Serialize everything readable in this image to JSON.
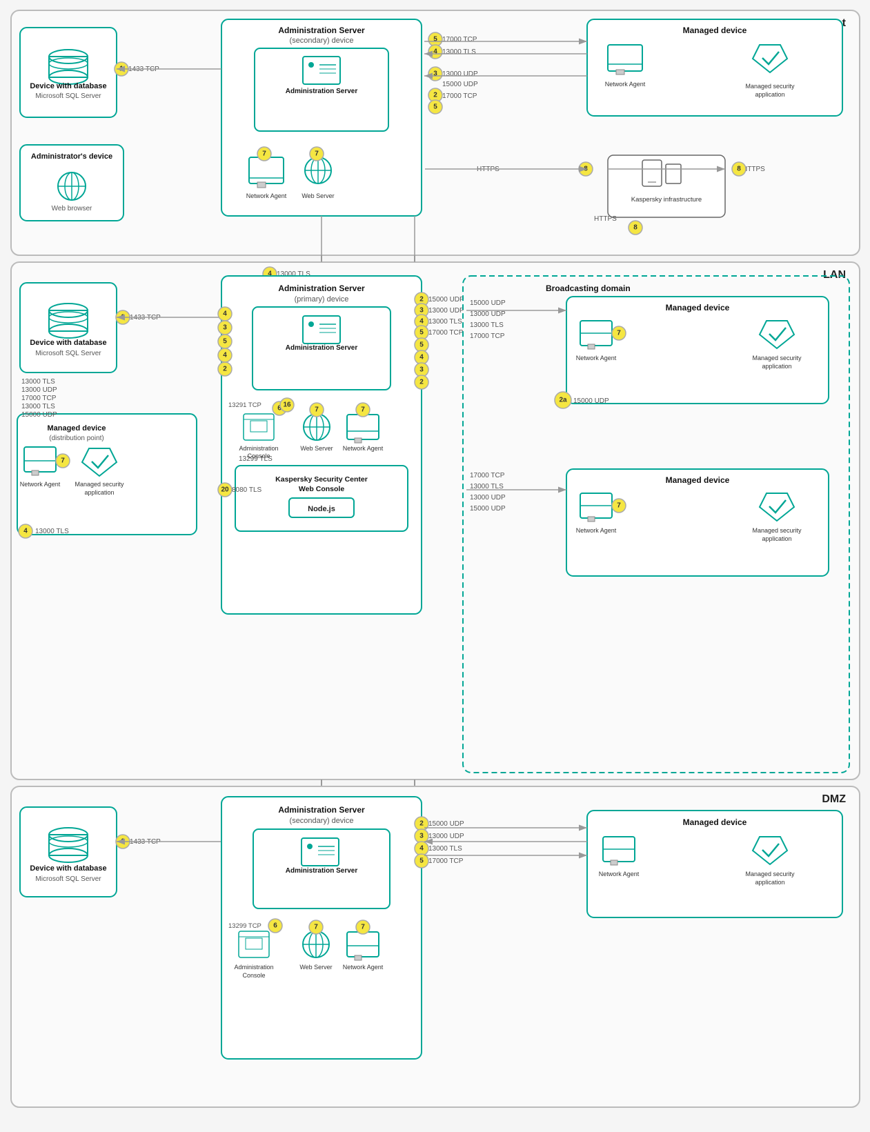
{
  "zones": {
    "internet": {
      "label": "Internet"
    },
    "lan": {
      "label": "LAN"
    },
    "dmz": {
      "label": "DMZ"
    }
  },
  "internet": {
    "db_device": {
      "title": "Device with database",
      "subtitle": "Microsoft SQL Server"
    },
    "admin_server_secondary": {
      "title": "Administration Server",
      "subtitle": "(secondary) device",
      "inner": "Administration Server"
    },
    "admin_device": {
      "title": "Administrator's device",
      "subtitle": "Web browser"
    },
    "managed_device": {
      "title": "Managed device",
      "network_agent": "Network Agent",
      "security_app": "Managed security application"
    },
    "network_agent_label": "Network Agent",
    "web_server_label": "Web Server",
    "kaspersky_infra": "Kaspersky infrastructure",
    "ports": {
      "p1": "1433 TCP",
      "p2": "17000 TCP",
      "p3_13000tls": "13000 TLS",
      "p4_13000udp": "13000 UDP",
      "p3b": "13000 UDP",
      "p2b": "15000 UDP",
      "p5b": "17000 TCP",
      "https1": "HTTPS",
      "https2": "HTTPS",
      "https3": "HTTPS"
    }
  },
  "lan": {
    "db_device": {
      "title": "Device with database",
      "subtitle": "Microsoft SQL Server"
    },
    "admin_server_primary": {
      "title": "Administration Server",
      "subtitle": "(primary) device",
      "inner": "Administration Server"
    },
    "ksc_webconsole": {
      "title": "Kaspersky Security Center\nWeb Console",
      "nodejs": "Node.js"
    },
    "managed_device_dp": {
      "title": "Managed device",
      "subtitle": "(distribution point)",
      "network_agent": "Network Agent",
      "security_app": "Managed security\napplication"
    },
    "broadcasting_domain": "Broadcasting domain",
    "managed_device_bd1": {
      "title": "Managed device",
      "network_agent": "Network Agent",
      "security_app": "Managed security\napplication"
    },
    "managed_device_bd2": {
      "title": "Managed device",
      "network_agent": "Network Agent",
      "security_app": "Managed security\napplication"
    },
    "ports": {
      "13000tls_top": "13000 TLS",
      "1433tcp": "1433 TCP",
      "13291tcp": "13291 TCP",
      "13299tls": "13299 TLS",
      "8080tls": "8080 TLS",
      "p13000tls_l": "13000 TLS",
      "p13000udp_l": "13000 UDP",
      "p17000tcp_l": "17000 TCP",
      "p13000tls_l2": "13000 TLS",
      "p15000udp_l": "15000 UDP",
      "p4_13000tls_bottom": "13000 TLS"
    },
    "admin_console_label": "Administration\nConsole",
    "web_server_label": "Web Server",
    "network_agent_label": "Network Agent"
  },
  "dmz": {
    "db_device": {
      "title": "Device with database",
      "subtitle": "Microsoft SQL Server"
    },
    "admin_server_secondary": {
      "title": "Administration Server",
      "subtitle": "(secondary) device",
      "inner": "Administration Server"
    },
    "managed_device": {
      "title": "Managed device",
      "network_agent": "Network Agent",
      "security_app": "Managed security\napplication"
    },
    "ports": {
      "p1": "1433 TCP",
      "p2": "15000 UDP",
      "p3": "13000 UDP",
      "p4": "13000 TLS",
      "p5": "17000 TCP",
      "p13299": "13299 TCP"
    },
    "admin_console_label": "Administration\nConsole",
    "web_server_label": "Web Server",
    "network_agent_label": "Network Agent"
  },
  "badges": {
    "1": "1",
    "2": "2",
    "3": "3",
    "4": "4",
    "5": "5",
    "6": "6",
    "7": "7",
    "8": "8",
    "16": "16",
    "20": "20",
    "2a": "2a"
  }
}
